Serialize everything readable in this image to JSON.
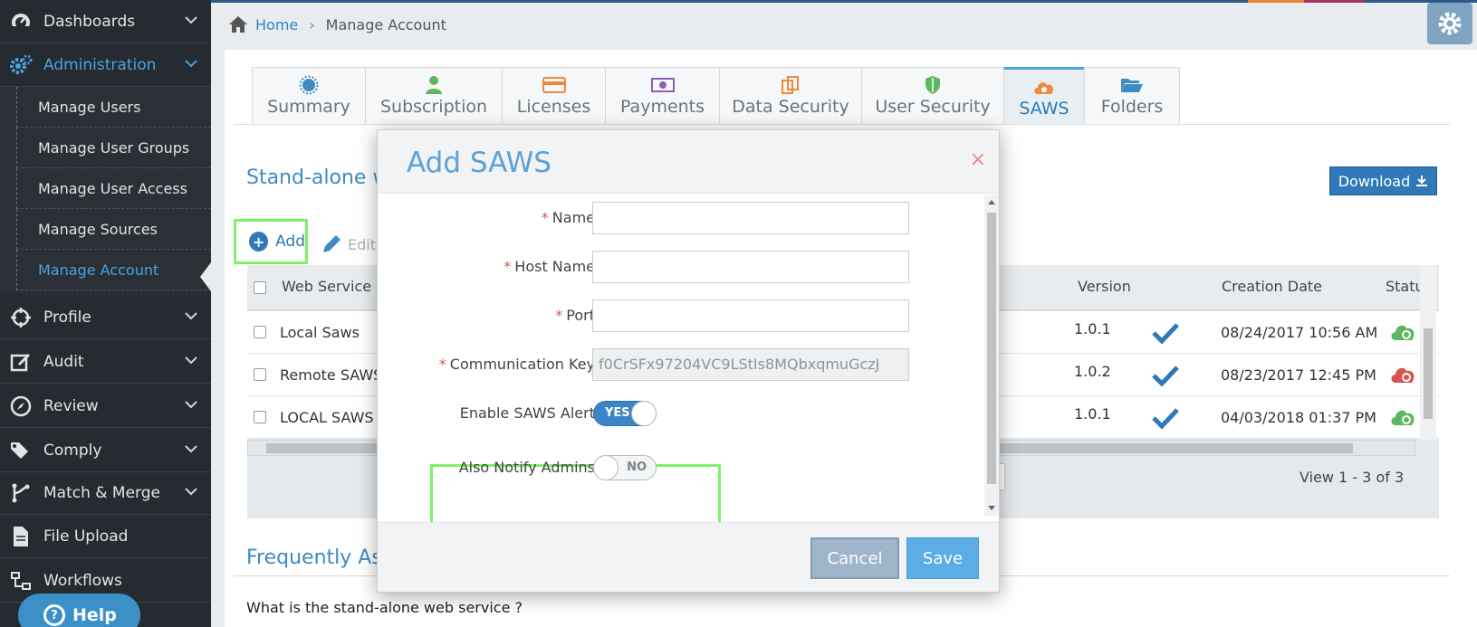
{
  "colors": {
    "sidebar_bg": "#252b30",
    "accent": "#4aa3df",
    "primary_button": "#3079b8",
    "highlight_box": "#7ef06a",
    "required": "#d9534f"
  },
  "sidebar": {
    "items": [
      {
        "label": "Dashboards",
        "icon": "dashboard-icon"
      },
      {
        "label": "Administration",
        "icon": "gears-icon",
        "active": true
      },
      {
        "label": "Profile",
        "icon": "crosshair-icon"
      },
      {
        "label": "Audit",
        "icon": "edit-icon"
      },
      {
        "label": "Review",
        "icon": "compass-icon"
      },
      {
        "label": "Comply",
        "icon": "tags-icon"
      },
      {
        "label": "Match & Merge",
        "icon": "merge-icon"
      },
      {
        "label": "File Upload",
        "icon": "file-icon"
      },
      {
        "label": "Workflows",
        "icon": "workflow-icon"
      }
    ],
    "subitems": [
      {
        "label": "Manage Users"
      },
      {
        "label": "Manage User Groups"
      },
      {
        "label": "Manage User Access"
      },
      {
        "label": "Manage Sources"
      },
      {
        "label": "Manage Account",
        "current": true
      }
    ],
    "help_label": "Help"
  },
  "breadcrumb": {
    "home": "Home",
    "current": "Manage Account"
  },
  "tabs": [
    {
      "label": "Summary",
      "icon": "sun-icon"
    },
    {
      "label": "Subscription",
      "icon": "user-icon"
    },
    {
      "label": "Licenses",
      "icon": "credit-card-icon"
    },
    {
      "label": "Payments",
      "icon": "money-icon"
    },
    {
      "label": "Data Security",
      "icon": "copy-icon"
    },
    {
      "label": "User Security",
      "icon": "shield-icon"
    },
    {
      "label": "SAWS",
      "icon": "cloud-gear-icon",
      "active": true
    },
    {
      "label": "Folders",
      "icon": "folder-open-icon"
    }
  ],
  "section": {
    "title": "Stand-alone w",
    "download_label": "Download"
  },
  "toolbar": {
    "add_label": "Add",
    "edit_label": "Edit"
  },
  "grid": {
    "headers": {
      "web_service": "Web Service",
      "version": "Version",
      "creation_date": "Creation Date",
      "status": "Statu"
    },
    "rows": [
      {
        "name": "Local Saws",
        "version": "1.0.1",
        "date": "08/24/2017 10:56 AM",
        "status_icon": "cloud-gear-green-icon"
      },
      {
        "name": "Remote SAWS",
        "version": "1.0.2",
        "date": "08/23/2017 12:45 PM",
        "status_icon": "cloud-gear-red-icon"
      },
      {
        "name": "LOCAL SAWS C",
        "version": "1.0.1",
        "date": "04/03/2018 01:37 PM",
        "status_icon": "cloud-gear-green-icon"
      }
    ],
    "view_text": "View 1 - 3 of 3"
  },
  "faq": {
    "title": "Frequently As",
    "question": "What is the stand-alone web service ?"
  },
  "modal": {
    "title": "Add SAWS",
    "close": "×",
    "fields": {
      "name_label": "Name",
      "name_value": "",
      "host_label": "Host Name",
      "host_value": "",
      "port_label": "Port",
      "port_value": "",
      "key_label": "Communication Key",
      "key_value": "f0CrSFx97204VC9LStIs8MQbxqmuGczJ"
    },
    "required_mark": "*",
    "enable_alert_label": "Enable SAWS Alert",
    "enable_alert_state": "YES",
    "notify_admins_label": "Also Notify Admins",
    "notify_admins_state": "NO",
    "cancel_label": "Cancel",
    "save_label": "Save"
  }
}
